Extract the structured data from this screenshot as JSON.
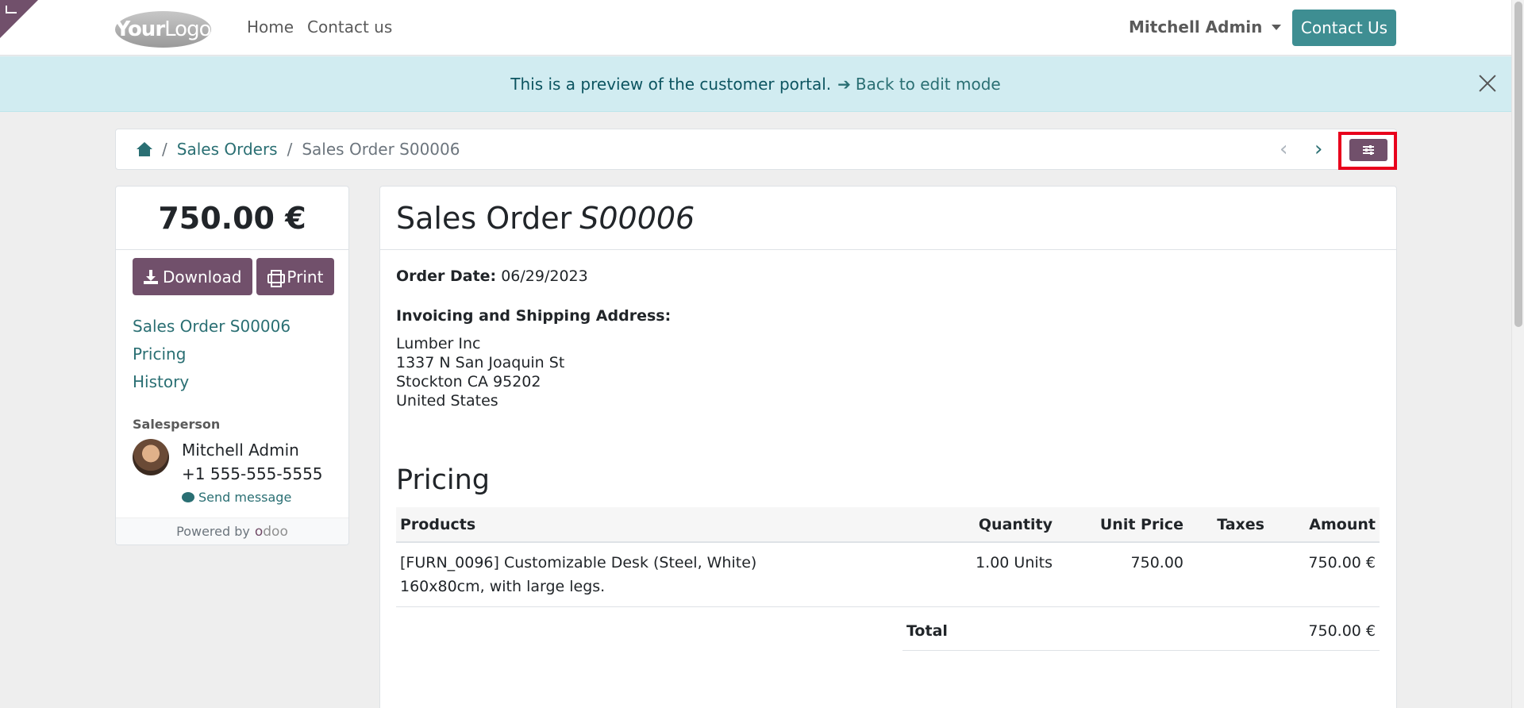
{
  "header": {
    "logo_text_bold": "Your",
    "logo_text": "Logo",
    "nav": [
      "Home",
      "Contact us"
    ],
    "user_name": "Mitchell Admin",
    "contact_button": "Contact Us"
  },
  "banner": {
    "text": "This is a preview of the customer portal.",
    "link": "Back to edit mode"
  },
  "breadcrumb": {
    "sales_orders": "Sales Orders",
    "current": "Sales Order S00006"
  },
  "sidebar": {
    "amount": "750.00 €",
    "download_label": "Download",
    "print_label": "Print",
    "links": [
      "Sales Order S00006",
      "Pricing",
      "History"
    ],
    "salesperson_label": "Salesperson",
    "salesperson_name": "Mitchell Admin",
    "salesperson_phone": "+1 555-555-5555",
    "send_message": "Send message",
    "powered_by": "Powered by",
    "odoo_brand_first": "o",
    "odoo_brand_rest": "doo"
  },
  "order": {
    "title": "Sales Order",
    "number": "S00006",
    "date_label": "Order Date:",
    "date": "06/29/2023",
    "address_label": "Invoicing and Shipping Address:",
    "address_lines": [
      "Lumber Inc",
      "1337 N San Joaquin St",
      "Stockton CA 95202",
      "United States"
    ],
    "pricing_heading": "Pricing",
    "columns": [
      "Products",
      "Quantity",
      "Unit Price",
      "Taxes",
      "Amount"
    ],
    "lines": [
      {
        "product": "[FURN_0096] Customizable Desk (Steel, White)",
        "description": "160x80cm, with large legs.",
        "quantity": "1.00 Units",
        "unit_price": "750.00",
        "taxes": "",
        "amount": "750.00 €"
      }
    ],
    "total_label": "Total",
    "total": "750.00 €"
  },
  "colors": {
    "primary": "#71506b",
    "accent": "#3e8e92",
    "link": "#2a6f73",
    "banner_bg": "#d1ecf1",
    "highlight": "#e8001c"
  },
  "icons": [
    "home-icon",
    "chevron-left-icon",
    "chevron-right-icon",
    "sliders-icon",
    "download-icon",
    "print-icon",
    "chat-icon",
    "close-icon",
    "arrow-right-icon"
  ]
}
